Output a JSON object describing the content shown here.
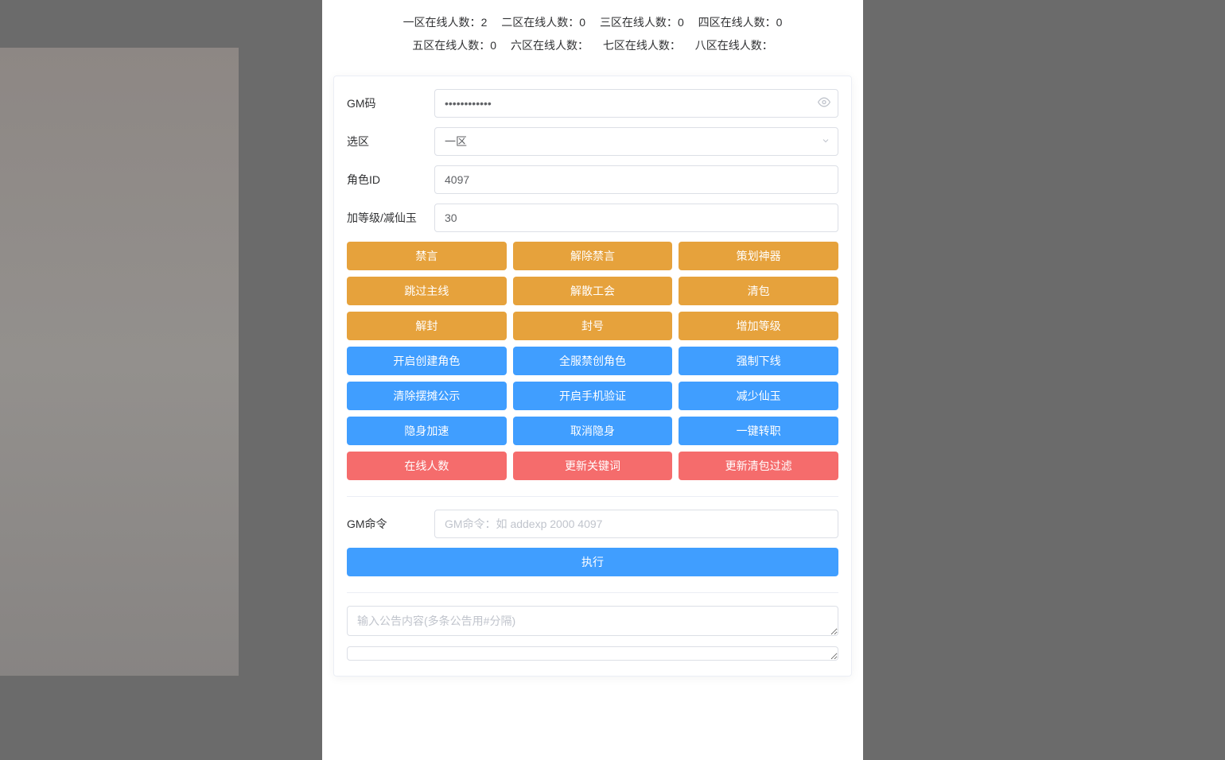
{
  "stats": [
    {
      "label": "一区在线人数：",
      "value": "2"
    },
    {
      "label": "二区在线人数：",
      "value": "0"
    },
    {
      "label": "三区在线人数：",
      "value": "0"
    },
    {
      "label": "四区在线人数：",
      "value": "0"
    },
    {
      "label": "五区在线人数：",
      "value": "0"
    },
    {
      "label": "六区在线人数：",
      "value": ""
    },
    {
      "label": "七区在线人数：",
      "value": ""
    },
    {
      "label": "八区在线人数：",
      "value": ""
    }
  ],
  "form": {
    "gm_code_label": "GM码",
    "gm_code_value": "••••••••••••",
    "region_label": "选区",
    "region_value": "一区",
    "role_id_label": "角色ID",
    "role_id_value": "4097",
    "level_label": "加等级/减仙玉",
    "level_value": "30",
    "gm_cmd_label": "GM命令",
    "gm_cmd_placeholder": "GM命令：如 addexp 2000 4097",
    "announce_placeholder": "输入公告内容(多条公告用#分隔)"
  },
  "buttons": {
    "row1": [
      "禁言",
      "解除禁言",
      "策划神器"
    ],
    "row2": [
      "跳过主线",
      "解散工会",
      "清包"
    ],
    "row3": [
      "解封",
      "封号",
      "增加等级"
    ],
    "row4": [
      "开启创建角色",
      "全服禁创角色",
      "强制下线"
    ],
    "row5": [
      "清除摆摊公示",
      "开启手机验证",
      "减少仙玉"
    ],
    "row6": [
      "隐身加速",
      "取消隐身",
      "一键转职"
    ],
    "row7": [
      "在线人数",
      "更新关键词",
      "更新清包过滤"
    ],
    "execute": "执行"
  }
}
